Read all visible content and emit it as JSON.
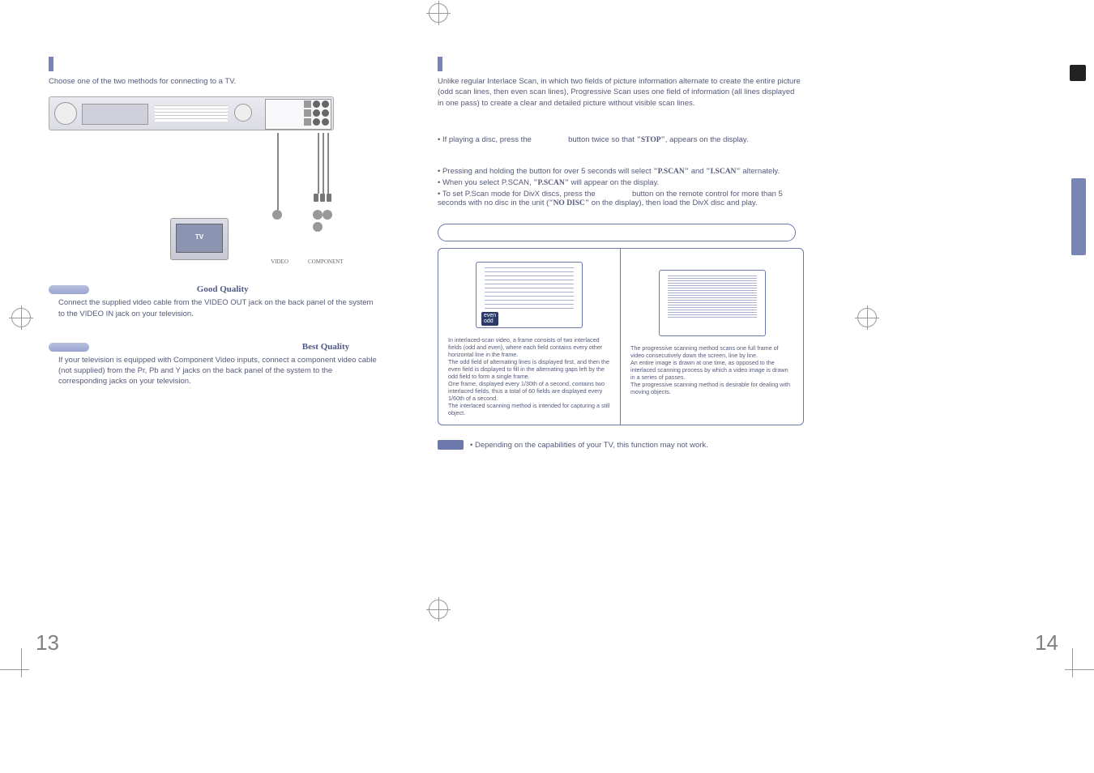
{
  "left": {
    "intro": "Choose one of the two methods for connecting to a TV.",
    "tv_label": "TV",
    "port_label_video": "VIDEO",
    "port_label_component": "COMPONENT",
    "method1_quality": "Good Quality",
    "method1_text": "Connect the supplied video cable from the VIDEO OUT jack on the back panel of the system to the VIDEO IN jack on your television.",
    "method2_quality": "Best Quality",
    "method2_text": "If your television is equipped with Component Video inputs, connect a component video cable (not supplied) from the Pr, Pb and Y jacks on the back panel of the system to the corresponding jacks on your television."
  },
  "right": {
    "intro": "Unlike regular Interlace Scan, in which two fields of picture information alternate to create the entire picture (odd scan lines, then even scan lines), Progressive Scan uses one field of information (all lines displayed in one pass) to create a clear and detailed picture without visible scan lines.",
    "b1a": "If playing a disc, press the",
    "b1b": "button twice so that",
    "b1_stop": "\"STOP\"",
    "b1c": ", appears on the display.",
    "b2": "Pressing and holding the button for over 5 seconds will select",
    "b2_pscan": "\"P.SCAN\"",
    "and": "and",
    "b2_iscan": "\"I.SCAN\"",
    "b2_end": "alternately.",
    "b3a": "When you select P.SCAN,",
    "b3_pscan": "\"P.SCAN\"",
    "b3b": "will appear on the display.",
    "b4a": "To set P.Scan mode for DivX discs, press the",
    "b4b": "button on the remote control for more than 5 seconds with no disc in the unit (",
    "b4_nodisc": "\"NO DISC\"",
    "b4c": " on the display), then load the DivX disc and play.",
    "interlaced_label": "even\nodd",
    "interlaced_text": "In interlaced-scan video, a frame consists of two interlaced fields (odd and even), where each field contains every other horizontal line in the frame.\nThe odd field of alternating lines is displayed first, and then the even field is displayed to fill in the alternating gaps left by the odd field to form a single frame.\nOne frame, displayed every 1/30th of a second, contains two interlaced fields, thus a total of 60 fields are displayed every 1/60th of a second.\nThe interlaced scanning method is intended for capturing a still object.",
    "progressive_text": "The progressive scanning method scans one full frame of video consecutively down the screen, line by line.\nAn entire image is drawn at one time, as opposed to the interlaced scanning process by which a video image is drawn in a series of passes.\nThe progressive scanning method is desirable for dealing with moving objects.",
    "note": "Depending on the capabilities of your TV, this function may not work."
  },
  "page_left_num": "13",
  "page_right_num": "14"
}
